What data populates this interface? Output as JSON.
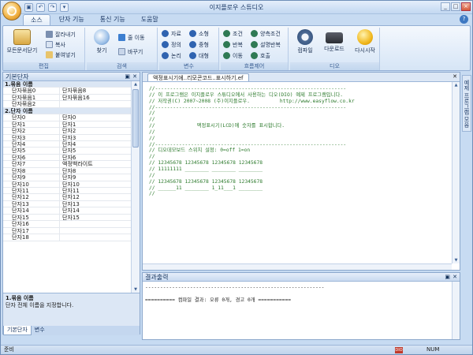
{
  "window": {
    "title": "이지플로우 스튜디오",
    "controls": [
      "_",
      "□",
      "×"
    ],
    "help": "?"
  },
  "ribbon": {
    "tabs": [
      "소스",
      "단자 기능",
      "통신 기능",
      "도움말"
    ],
    "groups": {
      "edit": {
        "label": "편집",
        "paste": "모든문서닫기",
        "cut": "잘라내기",
        "copy": "복사",
        "paste_small": "붙여넣기"
      },
      "search": {
        "label": "검색",
        "find": "찾기",
        "goto": "줄 이동",
        "replace": "바꾸기"
      },
      "variable": {
        "label": "변수",
        "items": [
          "자료",
          "소형",
          "정의",
          "중형",
          "논리",
          "대형"
        ]
      },
      "flow": {
        "label": "흐름제어",
        "items": [
          "조건",
          "양측조건",
          "반복",
          "설명반복",
          "이동",
          "호출"
        ]
      },
      "dio": {
        "label": "디오",
        "compile": "컴파일",
        "download": "다운로드",
        "restart": "다시시작"
      }
    }
  },
  "left_panel": {
    "title": "기본단자",
    "categories": [
      {
        "label": "1.묶음 이름",
        "rows": [
          [
            "단자묶음0",
            "단자묶음8"
          ],
          [
            "단자묶음1",
            "단자묶음16"
          ],
          [
            "단자묶음2",
            ""
          ]
        ]
      },
      {
        "label": "2.단자 이름",
        "rows": [
          [
            "단자0",
            "단자0"
          ],
          [
            "단자1",
            "단자1"
          ],
          [
            "단자2",
            "단자2"
          ],
          [
            "단자3",
            "단자3"
          ],
          [
            "단자4",
            "단자4"
          ],
          [
            "단자5",
            "단자5"
          ],
          [
            "단자6",
            "단자6"
          ],
          [
            "단자7",
            "액정백라이트"
          ],
          [
            "단자8",
            "단자8"
          ],
          [
            "단자9",
            "단자9"
          ],
          [
            "단자10",
            "단자10"
          ],
          [
            "단자11",
            "단자11"
          ],
          [
            "단자12",
            "단자12"
          ],
          [
            "단자13",
            "단자13"
          ],
          [
            "단자14",
            "단자14"
          ],
          [
            "단자15",
            "단자15"
          ],
          [
            "단자16",
            ""
          ],
          [
            "단자17",
            ""
          ],
          [
            "단자18",
            ""
          ]
        ]
      }
    ],
    "description": {
      "title": "1.묶음 이름",
      "text": "단자 전체 이름을 지정합니다."
    },
    "bottom_tabs": [
      "기본단자",
      "변수"
    ]
  },
  "editor": {
    "tab": "액정표시기에..리모콘코드..표시하기.ef",
    "lines": [
      "//----------------------------------------------------------------",
      "// 이 프로그램은 이지플로우 스튜디오에서 사용하는 디오(DIO) 예제 프로그램입니다.",
      "// 저작권(C) 2007~2008 (주)이지플로우.          http://www.easyflow.co.kr",
      "//----------------------------------------------------------------",
      "//",
      "//",
      "//              액정표시기(LCD)에 숫자를 표시합니다.",
      "//",
      "//",
      "//----------------------------------------------------------------",
      "// 디오데모보드 스위치 설정: 0=off 1=on",
      "//",
      "// 12345678 12345678 12345678 12345678",
      "// 11111111 ________ ________ ________",
      "//",
      "// 12345678 12345678 12345678 12345678",
      "// ______11 ________ 1_11___1 ________",
      "//"
    ]
  },
  "output": {
    "title": "결과출력",
    "lines": [
      "------------------------------------------------------------",
      "",
      "========== 컴파일 결과: 오류 0개, 경고 0개 ==========="
    ]
  },
  "right_sidebar": {
    "label": "예제 프로그램 모음"
  },
  "status": {
    "left": "준비",
    "num": "NUM",
    "dio": "DIO"
  }
}
